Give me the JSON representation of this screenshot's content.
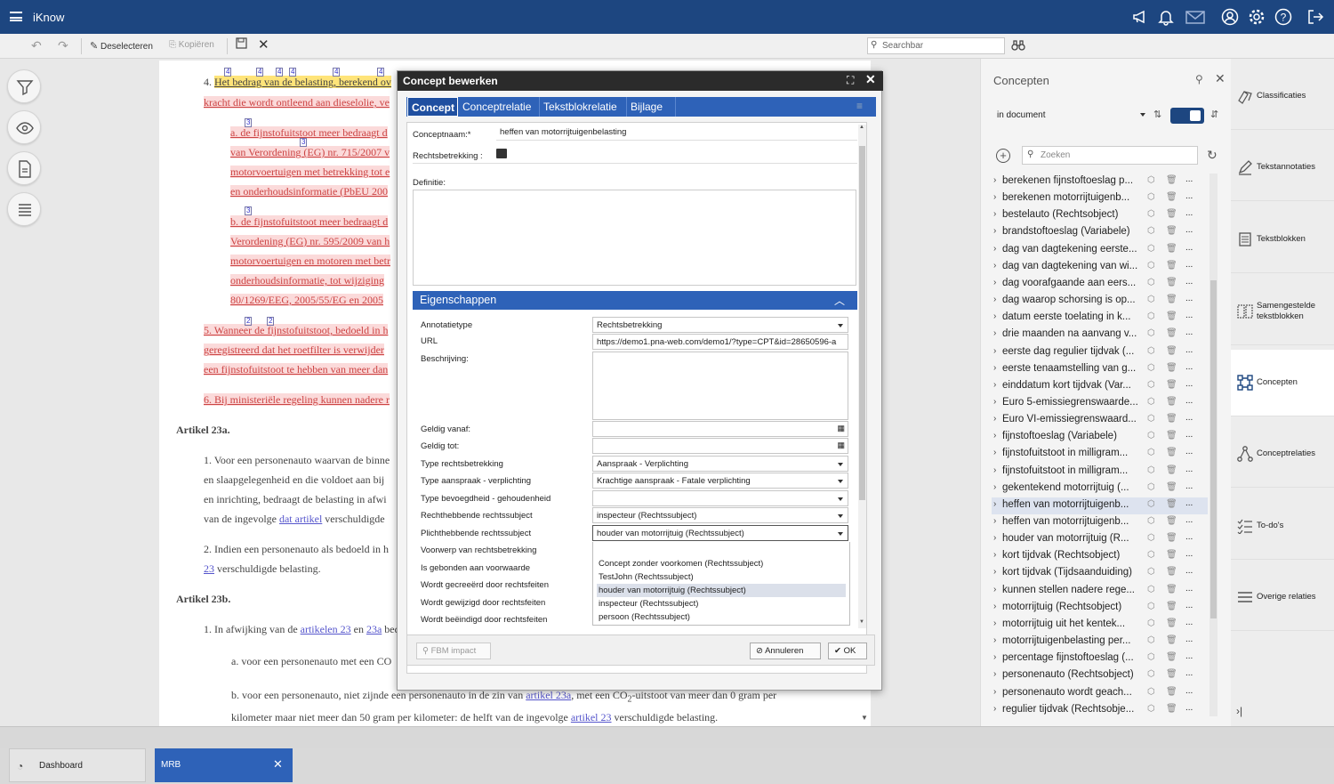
{
  "app": {
    "title": "iKnow"
  },
  "toolbar": {
    "deselect": "Deselecteren",
    "copy": "Kopiëren",
    "search_placeholder": "Searchbar"
  },
  "document": {
    "p4_start": "4.",
    "p4_line1a": "Het bedrag van de belasting, berekend ov",
    "p4_line2": "kracht die wordt ontleend aan dieselolie, ve",
    "pa_1": "a. de fijnstofuitstoot meer bedraagt d",
    "pa_2": "van Verordening (EG) nr. 715/2007 v",
    "pa_3": "motorvoertuigen met betrekking tot e",
    "pa_4": "en onderhoudsinformatie (PbEU 200",
    "pb_1": "b. de fijnstofuitstoot meer bedraagt d",
    "pb_2": "Verordening (EG) nr. 595/2009 van h",
    "pb_3": "motorvoertuigen en motoren met betr",
    "pb_4": "onderhoudsinformatie, tot wijziging",
    "pb_5": "80/1269/EEG, 2005/55/EG en 2005",
    "p5_1": "5. Wanneer de fijnstofuitstoot, bedoeld in h",
    "p5_2": "geregistreerd dat het roetfilter is verwijder",
    "p5_3": "een fijnstofuitstoot te hebben van meer dan",
    "p6": "6. Bij ministeriële regeling kunnen nadere r",
    "art23a": "Artikel 23a.",
    "a23a_1": "1. Voor een personenauto waarvan de binne",
    "a23a_1b": "en slaapgelegenheid en die voldoet aan bij",
    "a23a_1c": "en inrichting, bedraagt de belasting in afwi",
    "a23a_1d_pre": "van de ingevolge ",
    "a23a_1d_link": "dat artikel",
    "a23a_1d_post": " verschuldigde",
    "a23a_2": "2. Indien een personenauto als bedoeld in h",
    "a23a_2b_link": "23",
    "a23a_2b_post": " verschuldigde belasting.",
    "art23b": "Artikel 23b.",
    "a23b_1_pre": "1. In afwijking van de ",
    "a23b_1_link1": "artikelen 23",
    "a23b_1_mid": " en ",
    "a23b_1_link2": "23a",
    "a23b_1_post": " bedraagt de",
    "a23b_a": "a. voor een personenauto met een CO",
    "a23b_b_pre": "b. voor een personenauto, niet zijnde een personenauto in de zin van ",
    "a23b_b_link": "artikel 23a",
    "a23b_b_post": ", met een CO",
    "a23b_b_sub": "2",
    "a23b_b_post2": "-uitstoot van meer dan 0 gram per",
    "a23b_b2_pre": "kilometer maar niet meer dan 50 gram per kilometer: de helft van de ingevolge ",
    "a23b_b2_link": "artikel 23",
    "a23b_b2_post": " verschuldigde belasting.",
    "mark4": "4",
    "mark3": "3",
    "mark2": "2"
  },
  "dialog": {
    "title": "Concept bewerken",
    "tabs": [
      "Concept",
      "Conceptrelatie",
      "Tekstblokrelatie",
      "Bijlage"
    ],
    "conceptnaam_label": "Conceptnaam:*",
    "conceptnaam_value": "heffen van motorrijtuigenbelasting",
    "rechtsbetrekking_label": "Rechtsbetrekking :",
    "definitie_label": "Definitie:",
    "eigenschappen": "Eigenschappen",
    "props": {
      "annotatietype_label": "Annotatietype",
      "annotatietype_value": "Rechtsbetrekking",
      "url_label": "URL",
      "url_value": "https://demo1.pna-web.com/demo1/?type=CPT&id=28650596-a",
      "beschrijving_label": "Beschrijving:",
      "geldig_vanaf_label": "Geldig vanaf:",
      "geldig_tot_label": "Geldig tot:",
      "type_rb_label": "Type rechtsbetrekking",
      "type_rb_value": "Aanspraak - Verplichting",
      "type_av_label": "Type aanspraak - verplichting",
      "type_av_value": "Krachtige aanspraak - Fatale verplichting",
      "type_bh_label": "Type bevoegdheid - gehoudenheid",
      "recht_label": "Rechthebbende rechtssubject",
      "recht_value": "inspecteur (Rechtssubject)",
      "plicht_label": "Plichthebbende rechtssubject",
      "plicht_value": "houder van motorrijtuig (Rechtssubject)",
      "voorwerp_label": "Voorwerp van rechtsbetrekking",
      "gebonden_label": "Is gebonden aan voorwaarde",
      "gecreeerd_label": "Wordt gecreeërd door rechtsfeiten",
      "gewijzigd_label": "Wordt gewijzigd door rechtsfeiten",
      "beeindigd_label": "Wordt beëindigd door rechtsfeiten"
    },
    "dropdown_options": [
      "Concept zonder voorkomen (Rechtssubject)",
      "TestJohn (Rechtssubject)",
      "houder van motorrijtuig (Rechtssubject)",
      "inspecteur (Rechtssubject)",
      "persoon (Rechtssubject)"
    ],
    "dropdown_selected_index": 2,
    "fbm_impact": "FBM impact",
    "cancel": "Annuleren",
    "ok": "OK"
  },
  "concepts_panel": {
    "title": "Concepten",
    "filter_value": "in document",
    "search_placeholder": "Zoeken",
    "items": [
      "berekenen fijnstoftoeslag p...",
      "berekenen motorrijtuigenb...",
      "bestelauto (Rechtsobject)",
      "brandstoftoeslag (Variabele)",
      "dag van dagtekening eerste...",
      "dag van dagtekening van wi...",
      "dag voorafgaande aan eers...",
      "dag waarop schorsing is op...",
      "datum eerste toelating in k...",
      "drie maanden na aanvang v...",
      "eerste dag regulier tijdvak (...",
      "eerste tenaamstelling van g...",
      "einddatum kort tijdvak (Var...",
      "Euro 5-emissiegrenswaarde...",
      "Euro VI-emissiegrenswaard...",
      "fijnstoftoeslag (Variabele)",
      "fijnstofuitstoot in milligram...",
      "fijnstofuitstoot in milligram...",
      "gekentekend motorrijtuig (...",
      "heffen van motorrijtuigenb...",
      "heffen van motorrijtuigenb...",
      "houder van motorrijtuig (R...",
      "kort tijdvak (Rechtsobject)",
      "kort tijdvak (Tijdsaanduiding)",
      "kunnen stellen nadere rege...",
      "motorrijtuig (Rechtsobject)",
      "motorrijtuig uit het kentek...",
      "motorrijtuigenbelasting per...",
      "percentage fijnstoftoeslag (...",
      "personenauto (Rechtsobject)",
      "personenauto wordt geach...",
      "regulier tijdvak (Rechtsobje..."
    ],
    "selected_index": 19,
    "more": "..."
  },
  "right_nav": [
    {
      "label": "Classificaties",
      "icon": "classification-icon"
    },
    {
      "label": "Tekstannotaties",
      "icon": "annotation-icon"
    },
    {
      "label": "Tekstblokken",
      "icon": "textblock-icon"
    },
    {
      "label": "Samengestelde tekstblokken",
      "icon": "composite-textblock-icon"
    },
    {
      "label": "Concepten",
      "icon": "concepts-icon"
    },
    {
      "label": "Conceptrelaties",
      "icon": "concept-relations-icon"
    },
    {
      "label": "To-do's",
      "icon": "todo-icon"
    },
    {
      "label": "Overige relaties",
      "icon": "other-relations-icon"
    }
  ],
  "taskbar": {
    "dashboard": "Dashboard",
    "mrb": "MRB"
  }
}
